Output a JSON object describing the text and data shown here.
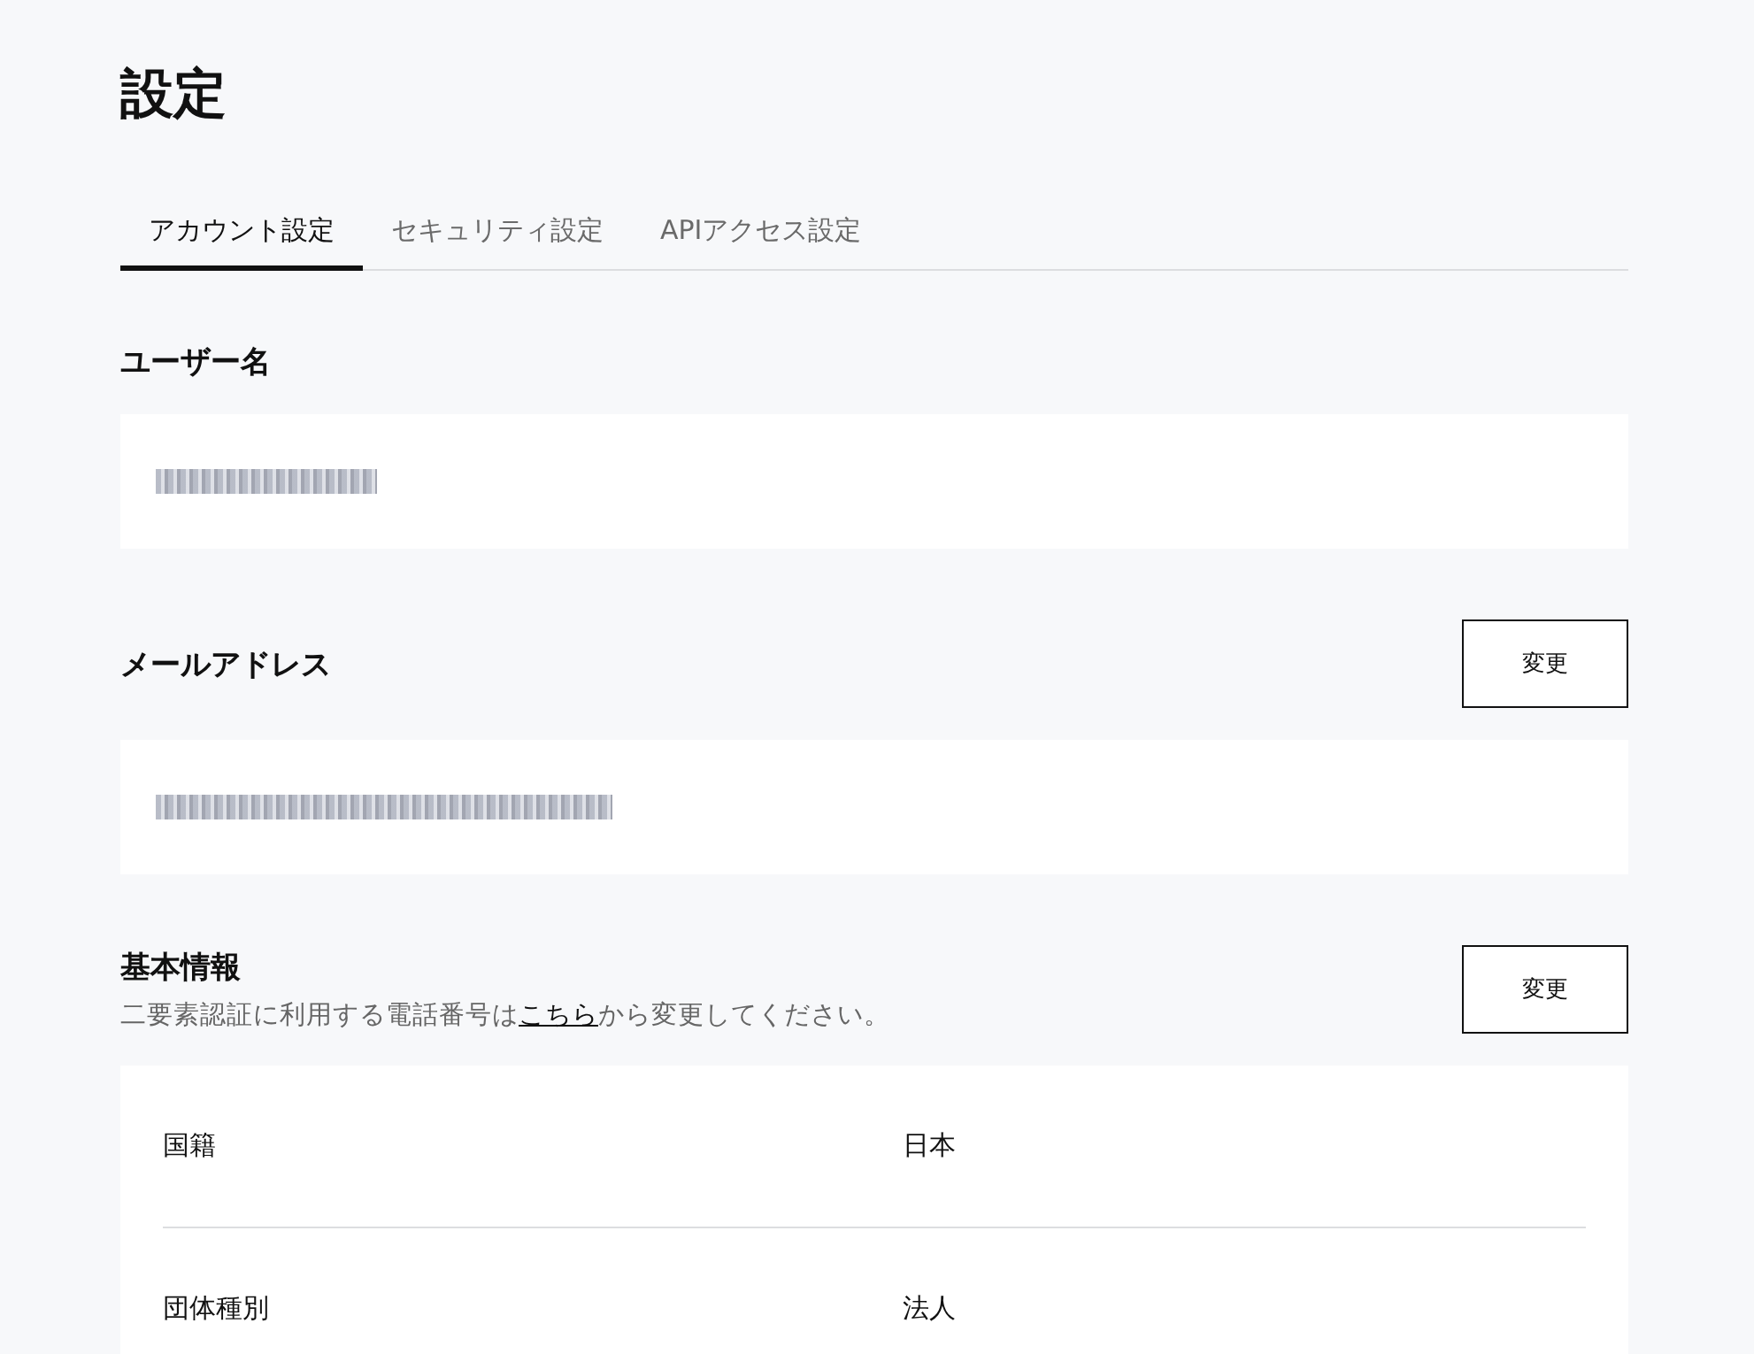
{
  "title": "設定",
  "tabs": [
    {
      "label": "アカウント設定",
      "selected": true
    },
    {
      "label": "セキュリティ設定",
      "selected": false
    },
    {
      "label": "APIアクセス設定",
      "selected": false
    }
  ],
  "sections": [
    {
      "kind": "field",
      "heading": "ユーザー名",
      "redacted": true
    },
    {
      "kind": "field",
      "heading": "メールアドレス",
      "button": "変更",
      "redacted": true
    },
    {
      "kind": "table",
      "heading": "基本情報",
      "button": "変更",
      "note": {
        "before": "二要素認証に利用する電話番号は",
        "link": "こちら",
        "after": "から変更してください。"
      },
      "rows": [
        {
          "label": "国籍",
          "value": "日本"
        },
        {
          "label": "団体種別",
          "value": "法人"
        }
      ]
    }
  ]
}
